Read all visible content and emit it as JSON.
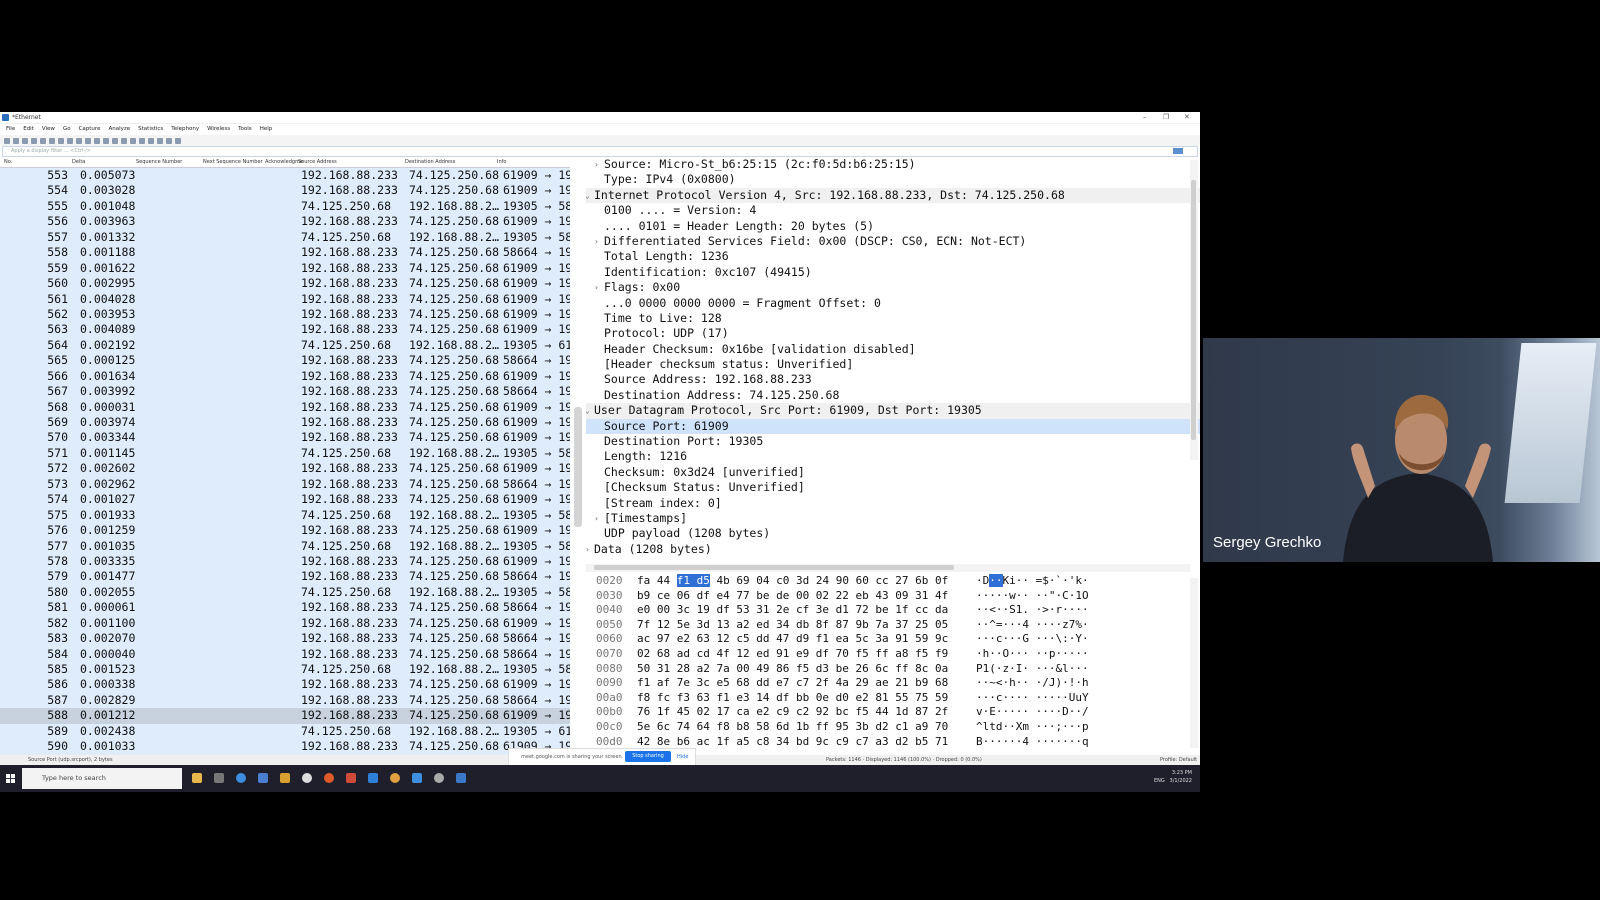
{
  "window": {
    "title": "*Ethernet",
    "menu": [
      "File",
      "Edit",
      "View",
      "Go",
      "Capture",
      "Analyze",
      "Statistics",
      "Telephony",
      "Wireless",
      "Tools",
      "Help"
    ],
    "filter_placeholder": "Apply a display filter ... <Ctrl-/>"
  },
  "packet_list": {
    "columns": [
      "No.",
      "Delta",
      "Sequence Number",
      "Next Sequence Number",
      "Acknowledgme",
      "Source Address",
      "Destination Address",
      "Info"
    ],
    "rows": [
      {
        "no": "553",
        "delta": "0.005073",
        "src": "192.168.88.233",
        "dst": "74.125.250.68",
        "info": "61909 → 19"
      },
      {
        "no": "554",
        "delta": "0.003028",
        "src": "192.168.88.233",
        "dst": "74.125.250.68",
        "info": "61909 → 19"
      },
      {
        "no": "555",
        "delta": "0.001048",
        "src": "74.125.250.68",
        "dst": "192.168.88.2…",
        "info": "19305 → 58"
      },
      {
        "no": "556",
        "delta": "0.003963",
        "src": "192.168.88.233",
        "dst": "74.125.250.68",
        "info": "61909 → 19"
      },
      {
        "no": "557",
        "delta": "0.001332",
        "src": "74.125.250.68",
        "dst": "192.168.88.2…",
        "info": "19305 → 58"
      },
      {
        "no": "558",
        "delta": "0.001188",
        "src": "192.168.88.233",
        "dst": "74.125.250.68",
        "info": "58664 → 19"
      },
      {
        "no": "559",
        "delta": "0.001622",
        "src": "192.168.88.233",
        "dst": "74.125.250.68",
        "info": "61909 → 19"
      },
      {
        "no": "560",
        "delta": "0.002995",
        "src": "192.168.88.233",
        "dst": "74.125.250.68",
        "info": "61909 → 19"
      },
      {
        "no": "561",
        "delta": "0.004028",
        "src": "192.168.88.233",
        "dst": "74.125.250.68",
        "info": "61909 → 19"
      },
      {
        "no": "562",
        "delta": "0.003953",
        "src": "192.168.88.233",
        "dst": "74.125.250.68",
        "info": "61909 → 19"
      },
      {
        "no": "563",
        "delta": "0.004089",
        "src": "192.168.88.233",
        "dst": "74.125.250.68",
        "info": "61909 → 19"
      },
      {
        "no": "564",
        "delta": "0.002192",
        "src": "74.125.250.68",
        "dst": "192.168.88.2…",
        "info": "19305 → 61"
      },
      {
        "no": "565",
        "delta": "0.000125",
        "src": "192.168.88.233",
        "dst": "74.125.250.68",
        "info": "58664 → 19"
      },
      {
        "no": "566",
        "delta": "0.001634",
        "src": "192.168.88.233",
        "dst": "74.125.250.68",
        "info": "61909 → 19"
      },
      {
        "no": "567",
        "delta": "0.003992",
        "src": "192.168.88.233",
        "dst": "74.125.250.68",
        "info": "58664 → 19"
      },
      {
        "no": "568",
        "delta": "0.000031",
        "src": "192.168.88.233",
        "dst": "74.125.250.68",
        "info": "61909 → 19"
      },
      {
        "no": "569",
        "delta": "0.003974",
        "src": "192.168.88.233",
        "dst": "74.125.250.68",
        "info": "61909 → 19"
      },
      {
        "no": "570",
        "delta": "0.003344",
        "src": "192.168.88.233",
        "dst": "74.125.250.68",
        "info": "61909 → 19"
      },
      {
        "no": "571",
        "delta": "0.001145",
        "src": "74.125.250.68",
        "dst": "192.168.88.2…",
        "info": "19305 → 58"
      },
      {
        "no": "572",
        "delta": "0.002602",
        "src": "192.168.88.233",
        "dst": "74.125.250.68",
        "info": "61909 → 19"
      },
      {
        "no": "573",
        "delta": "0.002962",
        "src": "192.168.88.233",
        "dst": "74.125.250.68",
        "info": "58664 → 19"
      },
      {
        "no": "574",
        "delta": "0.001027",
        "src": "192.168.88.233",
        "dst": "74.125.250.68",
        "info": "61909 → 19"
      },
      {
        "no": "575",
        "delta": "0.001933",
        "src": "74.125.250.68",
        "dst": "192.168.88.2…",
        "info": "19305 → 58"
      },
      {
        "no": "576",
        "delta": "0.001259",
        "src": "192.168.88.233",
        "dst": "74.125.250.68",
        "info": "61909 → 19"
      },
      {
        "no": "577",
        "delta": "0.001035",
        "src": "74.125.250.68",
        "dst": "192.168.88.2…",
        "info": "19305 → 58"
      },
      {
        "no": "578",
        "delta": "0.003335",
        "src": "192.168.88.233",
        "dst": "74.125.250.68",
        "info": "61909 → 19"
      },
      {
        "no": "579",
        "delta": "0.001477",
        "src": "192.168.88.233",
        "dst": "74.125.250.68",
        "info": "58664 → 19"
      },
      {
        "no": "580",
        "delta": "0.002055",
        "src": "74.125.250.68",
        "dst": "192.168.88.2…",
        "info": "19305 → 58"
      },
      {
        "no": "581",
        "delta": "0.000061",
        "src": "192.168.88.233",
        "dst": "74.125.250.68",
        "info": "58664 → 19"
      },
      {
        "no": "582",
        "delta": "0.001100",
        "src": "192.168.88.233",
        "dst": "74.125.250.68",
        "info": "61909 → 19"
      },
      {
        "no": "583",
        "delta": "0.002070",
        "src": "192.168.88.233",
        "dst": "74.125.250.68",
        "info": "58664 → 19"
      },
      {
        "no": "584",
        "delta": "0.000040",
        "src": "192.168.88.233",
        "dst": "74.125.250.68",
        "info": "58664 → 19"
      },
      {
        "no": "585",
        "delta": "0.001523",
        "src": "74.125.250.68",
        "dst": "192.168.88.2…",
        "info": "19305 → 58"
      },
      {
        "no": "586",
        "delta": "0.000338",
        "src": "192.168.88.233",
        "dst": "74.125.250.68",
        "info": "61909 → 19"
      },
      {
        "no": "587",
        "delta": "0.002829",
        "src": "192.168.88.233",
        "dst": "74.125.250.68",
        "info": "58664 → 19"
      },
      {
        "no": "588",
        "delta": "0.001212",
        "src": "192.168.88.233",
        "dst": "74.125.250.68",
        "info": "61909 → 19",
        "selected": true
      },
      {
        "no": "589",
        "delta": "0.002438",
        "src": "74.125.250.68",
        "dst": "192.168.88.2…",
        "info": "19305 → 61"
      },
      {
        "no": "590",
        "delta": "0.001033",
        "src": "192.168.88.233",
        "dst": "74.125.250.68",
        "info": "61909 → 19"
      }
    ]
  },
  "details": [
    {
      "text": "Source: Micro-St_b6:25:15 (2c:f0:5d:b6:25:15)",
      "indent": 1,
      "arrow": "›"
    },
    {
      "text": "Type: IPv4 (0x0800)",
      "indent": 1
    },
    {
      "text": "Internet Protocol Version 4, Src: 192.168.88.233, Dst: 74.125.250.68",
      "indent": 0,
      "arrow": "⌄",
      "hdr": true
    },
    {
      "text": "0100 .... = Version: 4",
      "indent": 1
    },
    {
      "text": ".... 0101 = Header Length: 20 bytes (5)",
      "indent": 1
    },
    {
      "text": "Differentiated Services Field: 0x00 (DSCP: CS0, ECN: Not-ECT)",
      "indent": 1,
      "arrow": "›"
    },
    {
      "text": "Total Length: 1236",
      "indent": 1
    },
    {
      "text": "Identification: 0xc107 (49415)",
      "indent": 1
    },
    {
      "text": "Flags: 0x00",
      "indent": 1,
      "arrow": "›"
    },
    {
      "text": "...0 0000 0000 0000 = Fragment Offset: 0",
      "indent": 1
    },
    {
      "text": "Time to Live: 128",
      "indent": 1
    },
    {
      "text": "Protocol: UDP (17)",
      "indent": 1
    },
    {
      "text": "Header Checksum: 0x16be [validation disabled]",
      "indent": 1
    },
    {
      "text": "[Header checksum status: Unverified]",
      "indent": 1
    },
    {
      "text": "Source Address: 192.168.88.233",
      "indent": 1
    },
    {
      "text": "Destination Address: 74.125.250.68",
      "indent": 1
    },
    {
      "text": "User Datagram Protocol, Src Port: 61909, Dst Port: 19305",
      "indent": 0,
      "arrow": "⌄",
      "hdr": true
    },
    {
      "text": "Source Port: 61909",
      "indent": 1,
      "selected": true
    },
    {
      "text": "Destination Port: 19305",
      "indent": 1
    },
    {
      "text": "Length: 1216",
      "indent": 1
    },
    {
      "text": "Checksum: 0x3d24 [unverified]",
      "indent": 1
    },
    {
      "text": "[Checksum Status: Unverified]",
      "indent": 1
    },
    {
      "text": "[Stream index: 0]",
      "indent": 1
    },
    {
      "text": "[Timestamps]",
      "indent": 1,
      "arrow": "›"
    },
    {
      "text": "UDP payload (1208 bytes)",
      "indent": 1
    },
    {
      "text": "Data (1208 bytes)",
      "indent": 0,
      "arrow": "›"
    }
  ],
  "bytes": [
    {
      "off": "0020",
      "pre": "fa 44 ",
      "hl": "f1 d5",
      "post": " 4b 69 04 c0  3d 24 90 60 cc 27 6b 0f",
      "apre": "·D",
      "ahl": "··",
      "apost": "Ki··  =$·`·'k·"
    },
    {
      "off": "0030",
      "pre": "b9 ce 06 df e4 77 be de  00 02 22 eb 43 09 31 4f",
      "apre": "·····w··  ··\"·C·1O"
    },
    {
      "off": "0040",
      "pre": "e0 00 3c 19 df 53 31 2e  cf 3e d1 72 be 1f cc da",
      "apre": "··<··S1.  ·>·r····"
    },
    {
      "off": "0050",
      "pre": "7f 12 5e 3d 13 a2 ed 34  db 8f 87 9b 7a 37 25 05",
      "apre": "··^=···4  ····z7%·"
    },
    {
      "off": "0060",
      "pre": "ac 97 e2 63 12 c5 dd 47  d9 f1 ea 5c 3a 91 59 9c",
      "apre": "···c···G  ···\\:·Y·"
    },
    {
      "off": "0070",
      "pre": "02 68 ad cd 4f 12 ed 91  e9 df 70 f5 ff a8 f5 f9",
      "apre": "·h··O···  ··p·····"
    },
    {
      "off": "0080",
      "pre": "50 31 28 a2 7a 00 49 86  f5 d3 be 26 6c ff 8c 0a",
      "apre": "P1(·z·I·  ···&l···"
    },
    {
      "off": "0090",
      "pre": "f1 af 7e 3c e5 68 dd e7  c7 2f 4a 29 ae 21 b9 68",
      "apre": "··~<·h··  ·/J)·!·h"
    },
    {
      "off": "00a0",
      "pre": "f8 fc f3 63 f1 e3 14 df  bb 0e d0 e2 81 55 75 59",
      "apre": "···c····  ·····UuY"
    },
    {
      "off": "00b0",
      "pre": "76 1f 45 02 17 ca e2 c9  c2 92 bc f5 44 1d 87 2f",
      "apre": "v·E·····  ····D··/"
    },
    {
      "off": "00c0",
      "pre": "5e 6c 74 64 f8 b8 58 6d  1b ff 95 3b d2 c1 a9 70",
      "apre": "^ltd··Xm  ···;···p"
    },
    {
      "off": "00d0",
      "pre": "42 8e b6 ac 1f a5 c8 34  bd 9c c9 c7 a3 d2 b5 71",
      "apre": "B······4  ·······q"
    }
  ],
  "statusbar": {
    "left": "Source Port (udp.srcport), 2 bytes",
    "middle": "Packets: 1146 · Displayed: 1146 (100.0%) · Dropped: 0 (0.0%)",
    "right": "Profile: Default"
  },
  "share_banner": {
    "text": "meet.google.com is sharing your screen.",
    "button": "Stop sharing",
    "hide": "Hide"
  },
  "taskbar": {
    "search_placeholder": "Type here to search",
    "time": "3:23 PM",
    "date": "3/1/2022",
    "lang": "ENG"
  },
  "participant": {
    "name": "Sergey Grechko"
  },
  "colors": {
    "packet_list_bg": "#dfecfb",
    "selected_row": "#c7d2de",
    "byte_highlight": "#2f6fd6",
    "accent": "#1a73e8"
  }
}
